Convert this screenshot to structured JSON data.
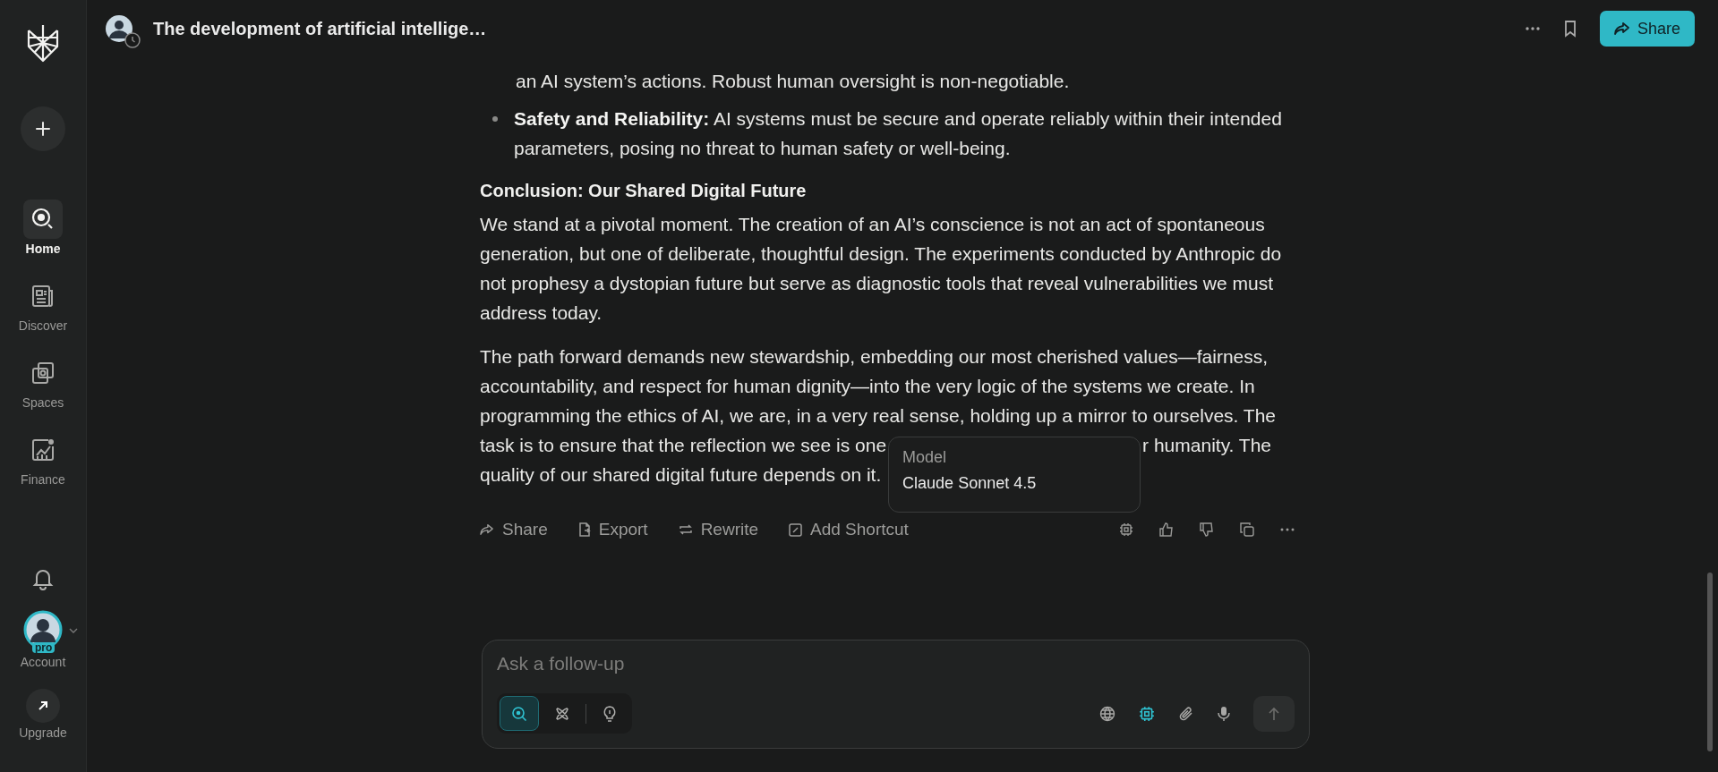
{
  "header": {
    "title": "The development of artificial intellige…",
    "share_button": "Share"
  },
  "sidebar": {
    "items": [
      {
        "kind": "home",
        "label": "Home",
        "selected": true
      },
      {
        "kind": "discover",
        "label": "Discover",
        "selected": false
      },
      {
        "kind": "spaces",
        "label": "Spaces",
        "selected": false
      },
      {
        "kind": "finance",
        "label": "Finance",
        "selected": false
      }
    ],
    "account_label": "Account",
    "account_badge": "pro",
    "upgrade_label": "Upgrade"
  },
  "answer": {
    "blocks": [
      {
        "kind": "continuation",
        "lines": [
          "an AI system’s actions. Robust human oversight is non-negotiable."
        ]
      },
      {
        "kind": "bullet",
        "lines": [
          "**Safety and Reliability:** AI systems must be secure and operate reliably within their intended",
          "parameters, posing no threat to human safety or well-being."
        ]
      },
      {
        "kind": "heading",
        "lines": [
          "Conclusion: Our Shared Digital Future"
        ]
      },
      {
        "kind": "paragraph",
        "lines": [
          "We stand at a pivotal moment. The creation of an AI’s conscience is not an act of spontaneous",
          "generation, but one of deliberate, thoughtful design. The experiments conducted by Anthropic do",
          "not prophesy a dystopian future but serve as diagnostic tools that reveal vulnerabilities we must",
          "address today."
        ]
      },
      {
        "kind": "covered",
        "lines": [
          "The path forward demands new stewardship, embedding our most cherished values—fairness,",
          "accountability, and respect for human dignity—into the very logic of the systems we create. In",
          "programming the ethics of AI, we are, in a very real sense, holding up a mirror to ourselves. The"
        ],
        "covered_line": {
          "before": "task is to ensure that the reflection we see is one",
          "after": "r humanity. The"
        },
        "last_line": "quality of our shared digital future depends on it.",
        "tooltip": {
          "label": "Model",
          "value": "Claude Sonnet 4.5"
        }
      }
    ]
  },
  "actions": [
    {
      "kind": "share",
      "label": "Share"
    },
    {
      "kind": "export",
      "label": "Export"
    },
    {
      "kind": "rewrite",
      "label": "Rewrite"
    },
    {
      "kind": "shortcut",
      "label": "Add Shortcut"
    }
  ],
  "composer": {
    "placeholder": "Ask a follow-up",
    "modes": [
      {
        "kind": "search",
        "selected": true
      },
      {
        "kind": "research",
        "selected": false
      },
      {
        "kind": "labs",
        "selected": false
      }
    ],
    "tools": [
      {
        "kind": "globe",
        "active": false
      },
      {
        "kind": "chip",
        "active": true
      },
      {
        "kind": "clip",
        "active": false
      },
      {
        "kind": "mic",
        "active": false
      }
    ],
    "send_disabled": true
  }
}
